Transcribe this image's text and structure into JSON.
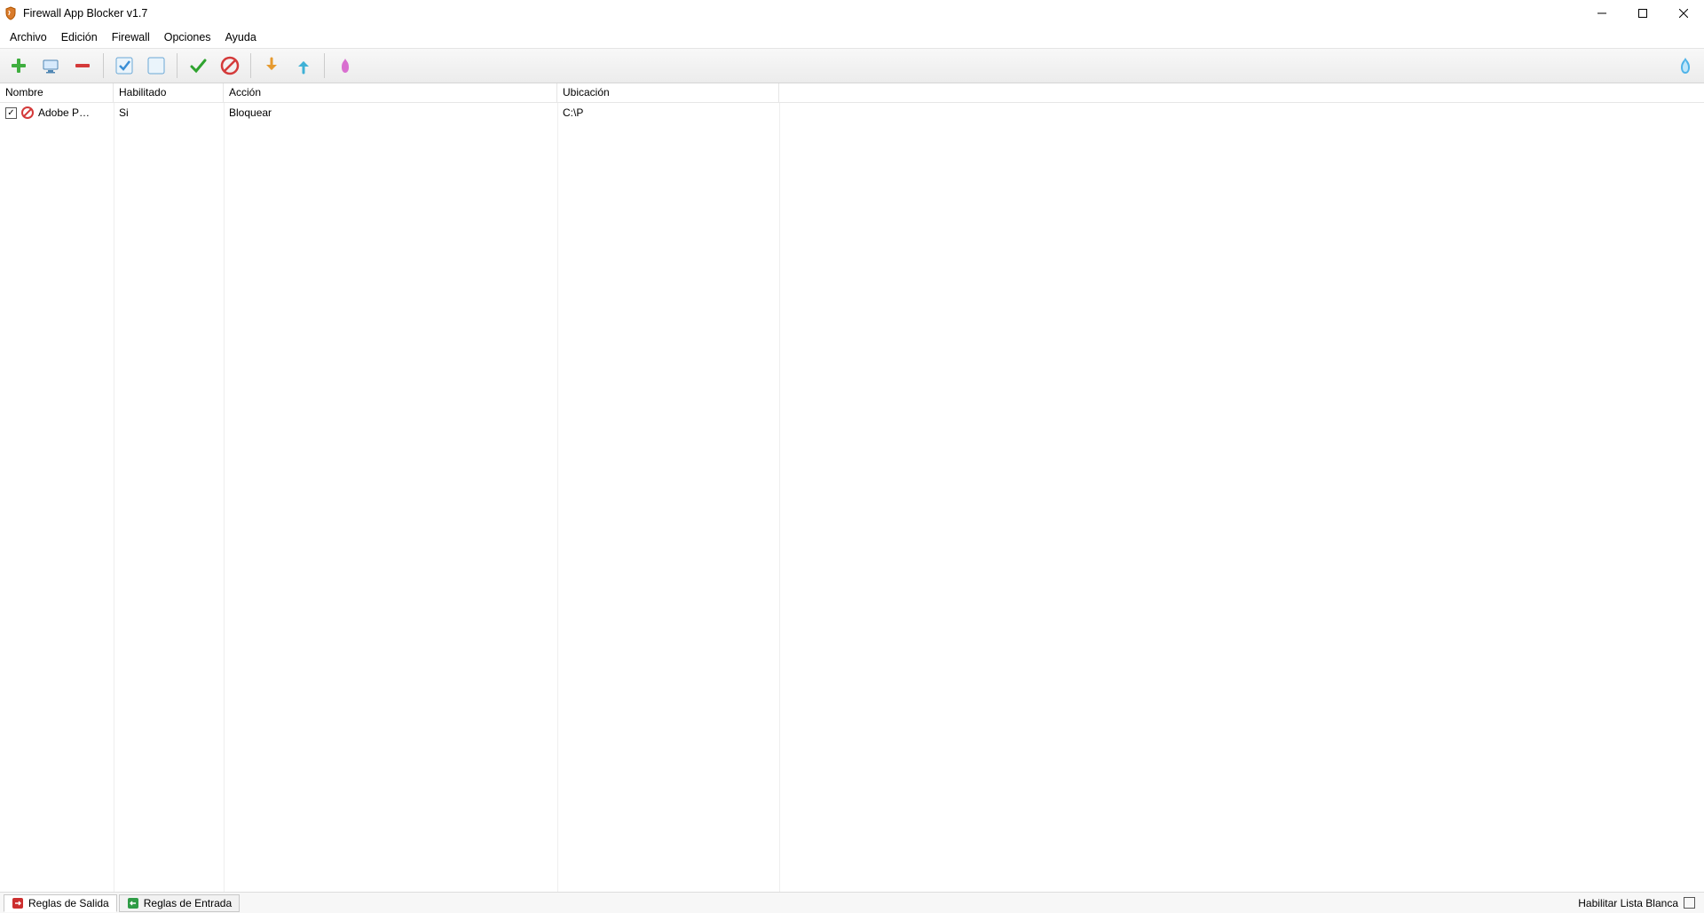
{
  "title": "Firewall App Blocker v1.7",
  "menu": [
    "Archivo",
    "Edición",
    "Firewall",
    "Opciones",
    "Ayuda"
  ],
  "toolbar_icons": [
    "add-icon",
    "process-icon",
    "remove-icon",
    "enable-icon",
    "disable-icon",
    "allow-icon",
    "block-icon",
    "import-icon",
    "export-icon",
    "firewall-icon"
  ],
  "columns": {
    "nombre": "Nombre",
    "habilitado": "Habilitado",
    "accion": "Acción",
    "ubicacion": "Ubicación"
  },
  "rows": [
    {
      "checked": true,
      "nombre": "Adobe P…",
      "habilitado": "Si",
      "accion": "Bloquear",
      "ubicacion": "C:\\P"
    }
  ],
  "tabs": {
    "salida": "Reglas de Salida",
    "entrada": "Reglas de Entrada"
  },
  "whitelist_label": "Habilitar Lista Blanca"
}
